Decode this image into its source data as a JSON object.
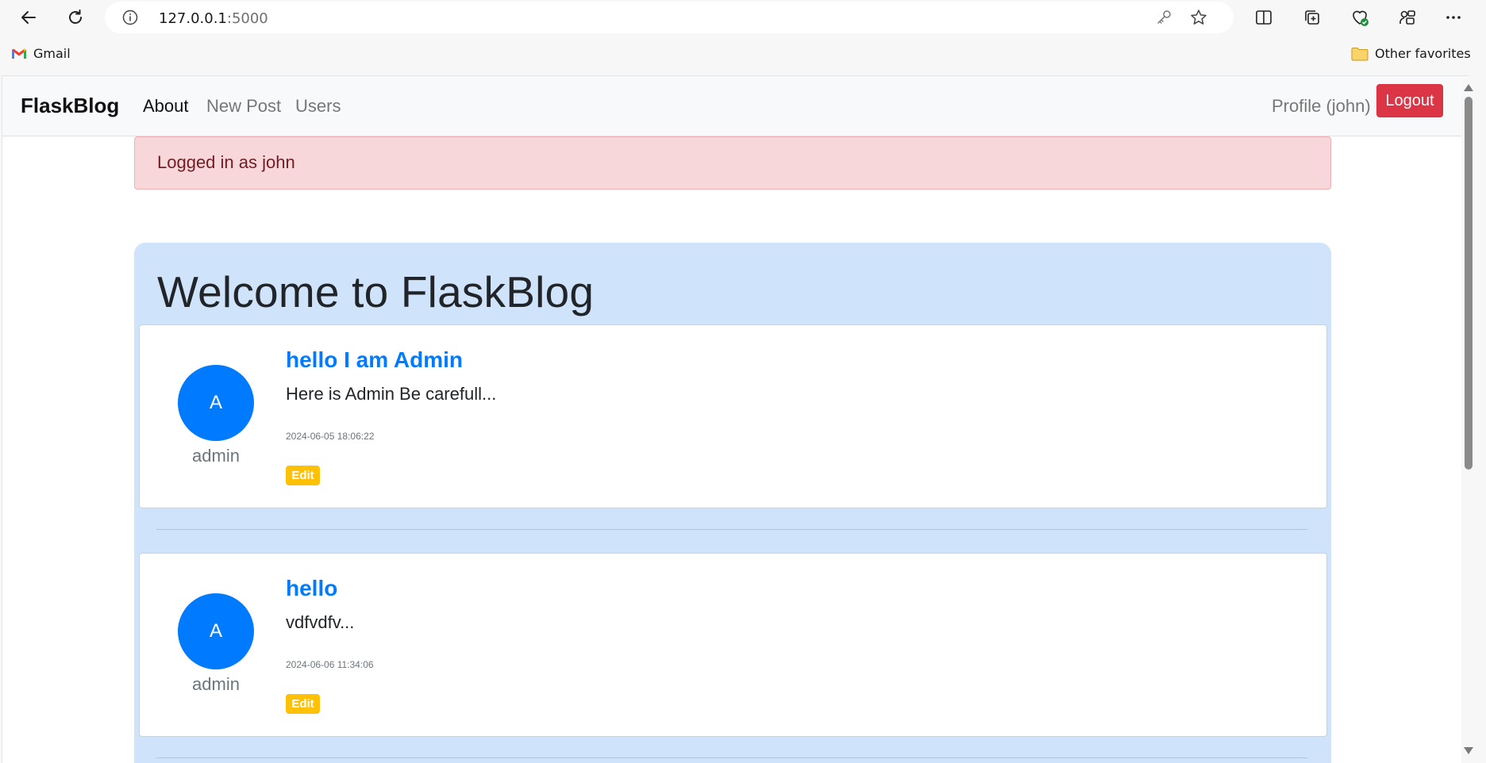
{
  "browser": {
    "url_host": "127.0.0.1",
    "url_port": ":5000",
    "bookmarks": [
      {
        "label": "Gmail",
        "icon": "gmail-icon"
      },
      {
        "label": "Other favorites",
        "icon": "folder-icon"
      }
    ]
  },
  "site": {
    "brand": "FlaskBlog",
    "nav_links": [
      "About",
      "New Post",
      "Users"
    ],
    "profile_link": "Profile (john)",
    "logout_label": "Logout"
  },
  "alert": {
    "message": "Logged in as john"
  },
  "main": {
    "title": "Welcome to FlaskBlog",
    "posts": [
      {
        "avatar_letter": "A",
        "author": "admin",
        "title": "hello I am Admin",
        "excerpt": "Here is Admin Be carefull...",
        "date": "2024-06-05 18:06:22",
        "edit_label": "Edit"
      },
      {
        "avatar_letter": "A",
        "author": "admin",
        "title": "hello",
        "excerpt": "vdfvdfv...",
        "date": "2024-06-06 11:34:06",
        "edit_label": "Edit"
      }
    ]
  },
  "colors": {
    "primary": "#007bff",
    "danger": "#dc3545",
    "warning": "#ffc107",
    "alert_bg": "#f8d7da",
    "jumbotron_bg": "#cfe4fb"
  }
}
